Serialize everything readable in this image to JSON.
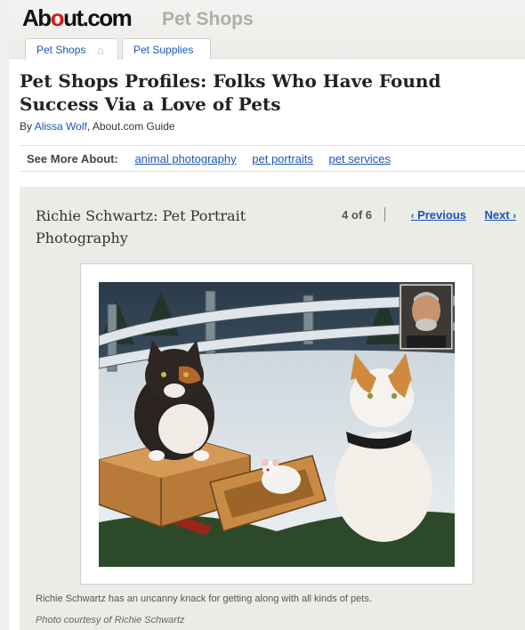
{
  "header": {
    "logo_pre": "Ab",
    "logo_o": "o",
    "logo_post": "ut.com",
    "site_name": "Pet Shops",
    "tabs": [
      {
        "label": "Pet Shops",
        "icon": "home-icon"
      },
      {
        "label": "Pet Supplies"
      }
    ]
  },
  "article": {
    "title": "Pet Shops Profiles: Folks Who Have Found Success Via a Love of Pets",
    "by_prefix": "By ",
    "author": "Alissa Wolf",
    "by_suffix": ", About.com Guide"
  },
  "see_more": {
    "label": "See More About:",
    "tags": [
      "animal photography",
      "pet portraits",
      "pet services"
    ]
  },
  "slideshow": {
    "title": "Richie Schwartz: Pet Portrait Photography",
    "counter": "4 of 6",
    "prev_label": "Previous",
    "next_label": "Next",
    "image_subject": "calico cat, orange and white cat and white rat on wooden crates in snowy scene, with inset portrait of photographer",
    "caption": "Richie Schwartz has an uncanny knack for getting along with all kinds of pets.",
    "credit": "Photo courtesy of Richie Schwartz"
  },
  "colors": {
    "link": "#1a56b8",
    "logo_red": "#d11a1a",
    "site_name_gray": "#b0aea6",
    "panel_bg": "#ebebe8"
  }
}
